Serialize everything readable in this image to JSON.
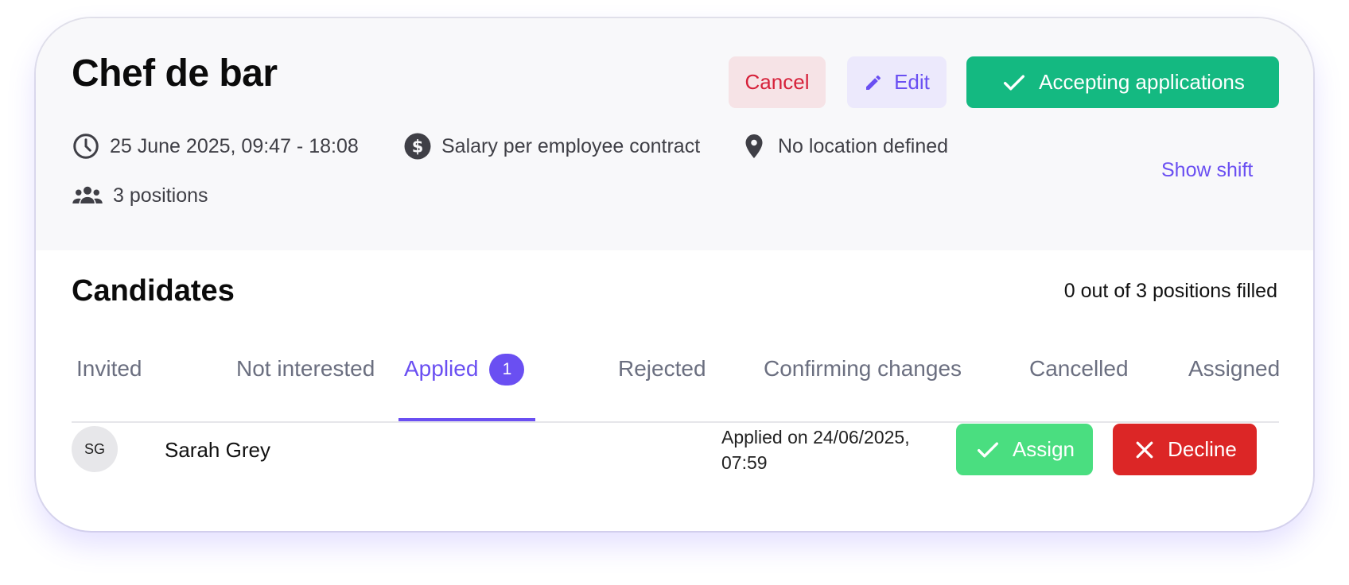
{
  "job": {
    "title": "Chef de bar",
    "date_time": "25 June 2025, 09:47 - 18:08",
    "salary": "Salary per employee contract",
    "location": "No location defined",
    "positions": "3 positions",
    "show_shift_label": "Show shift"
  },
  "actions": {
    "cancel_label": "Cancel",
    "edit_label": "Edit",
    "accepting_label": "Accepting applications"
  },
  "candidates": {
    "title": "Candidates",
    "filled_text": "0 out of 3 positions filled",
    "tabs": [
      {
        "label": "Invited"
      },
      {
        "label": "Not interested"
      },
      {
        "label": "Applied",
        "badge": "1"
      },
      {
        "label": "Rejected"
      },
      {
        "label": "Confirming changes"
      },
      {
        "label": "Cancelled"
      },
      {
        "label": "Assigned"
      }
    ],
    "active_tab": "Applied",
    "list": [
      {
        "initials": "SG",
        "name": "Sarah Grey",
        "applied_line1": "Applied on 24/06/2025,",
        "applied_line2": "07:59",
        "assign_label": "Assign",
        "decline_label": "Decline"
      }
    ]
  },
  "colors": {
    "accent": "#6a4ff2",
    "success": "#14b981",
    "assign": "#4ade80",
    "danger": "#dc2626",
    "cancel_text": "#d6213a"
  },
  "icons": {
    "edit": "pencil-icon",
    "accepting": "check-icon",
    "date": "clock-icon",
    "salary": "dollar-icon",
    "location": "map-pin-icon",
    "positions": "users-icon",
    "assign": "check-icon",
    "decline": "close-icon"
  }
}
